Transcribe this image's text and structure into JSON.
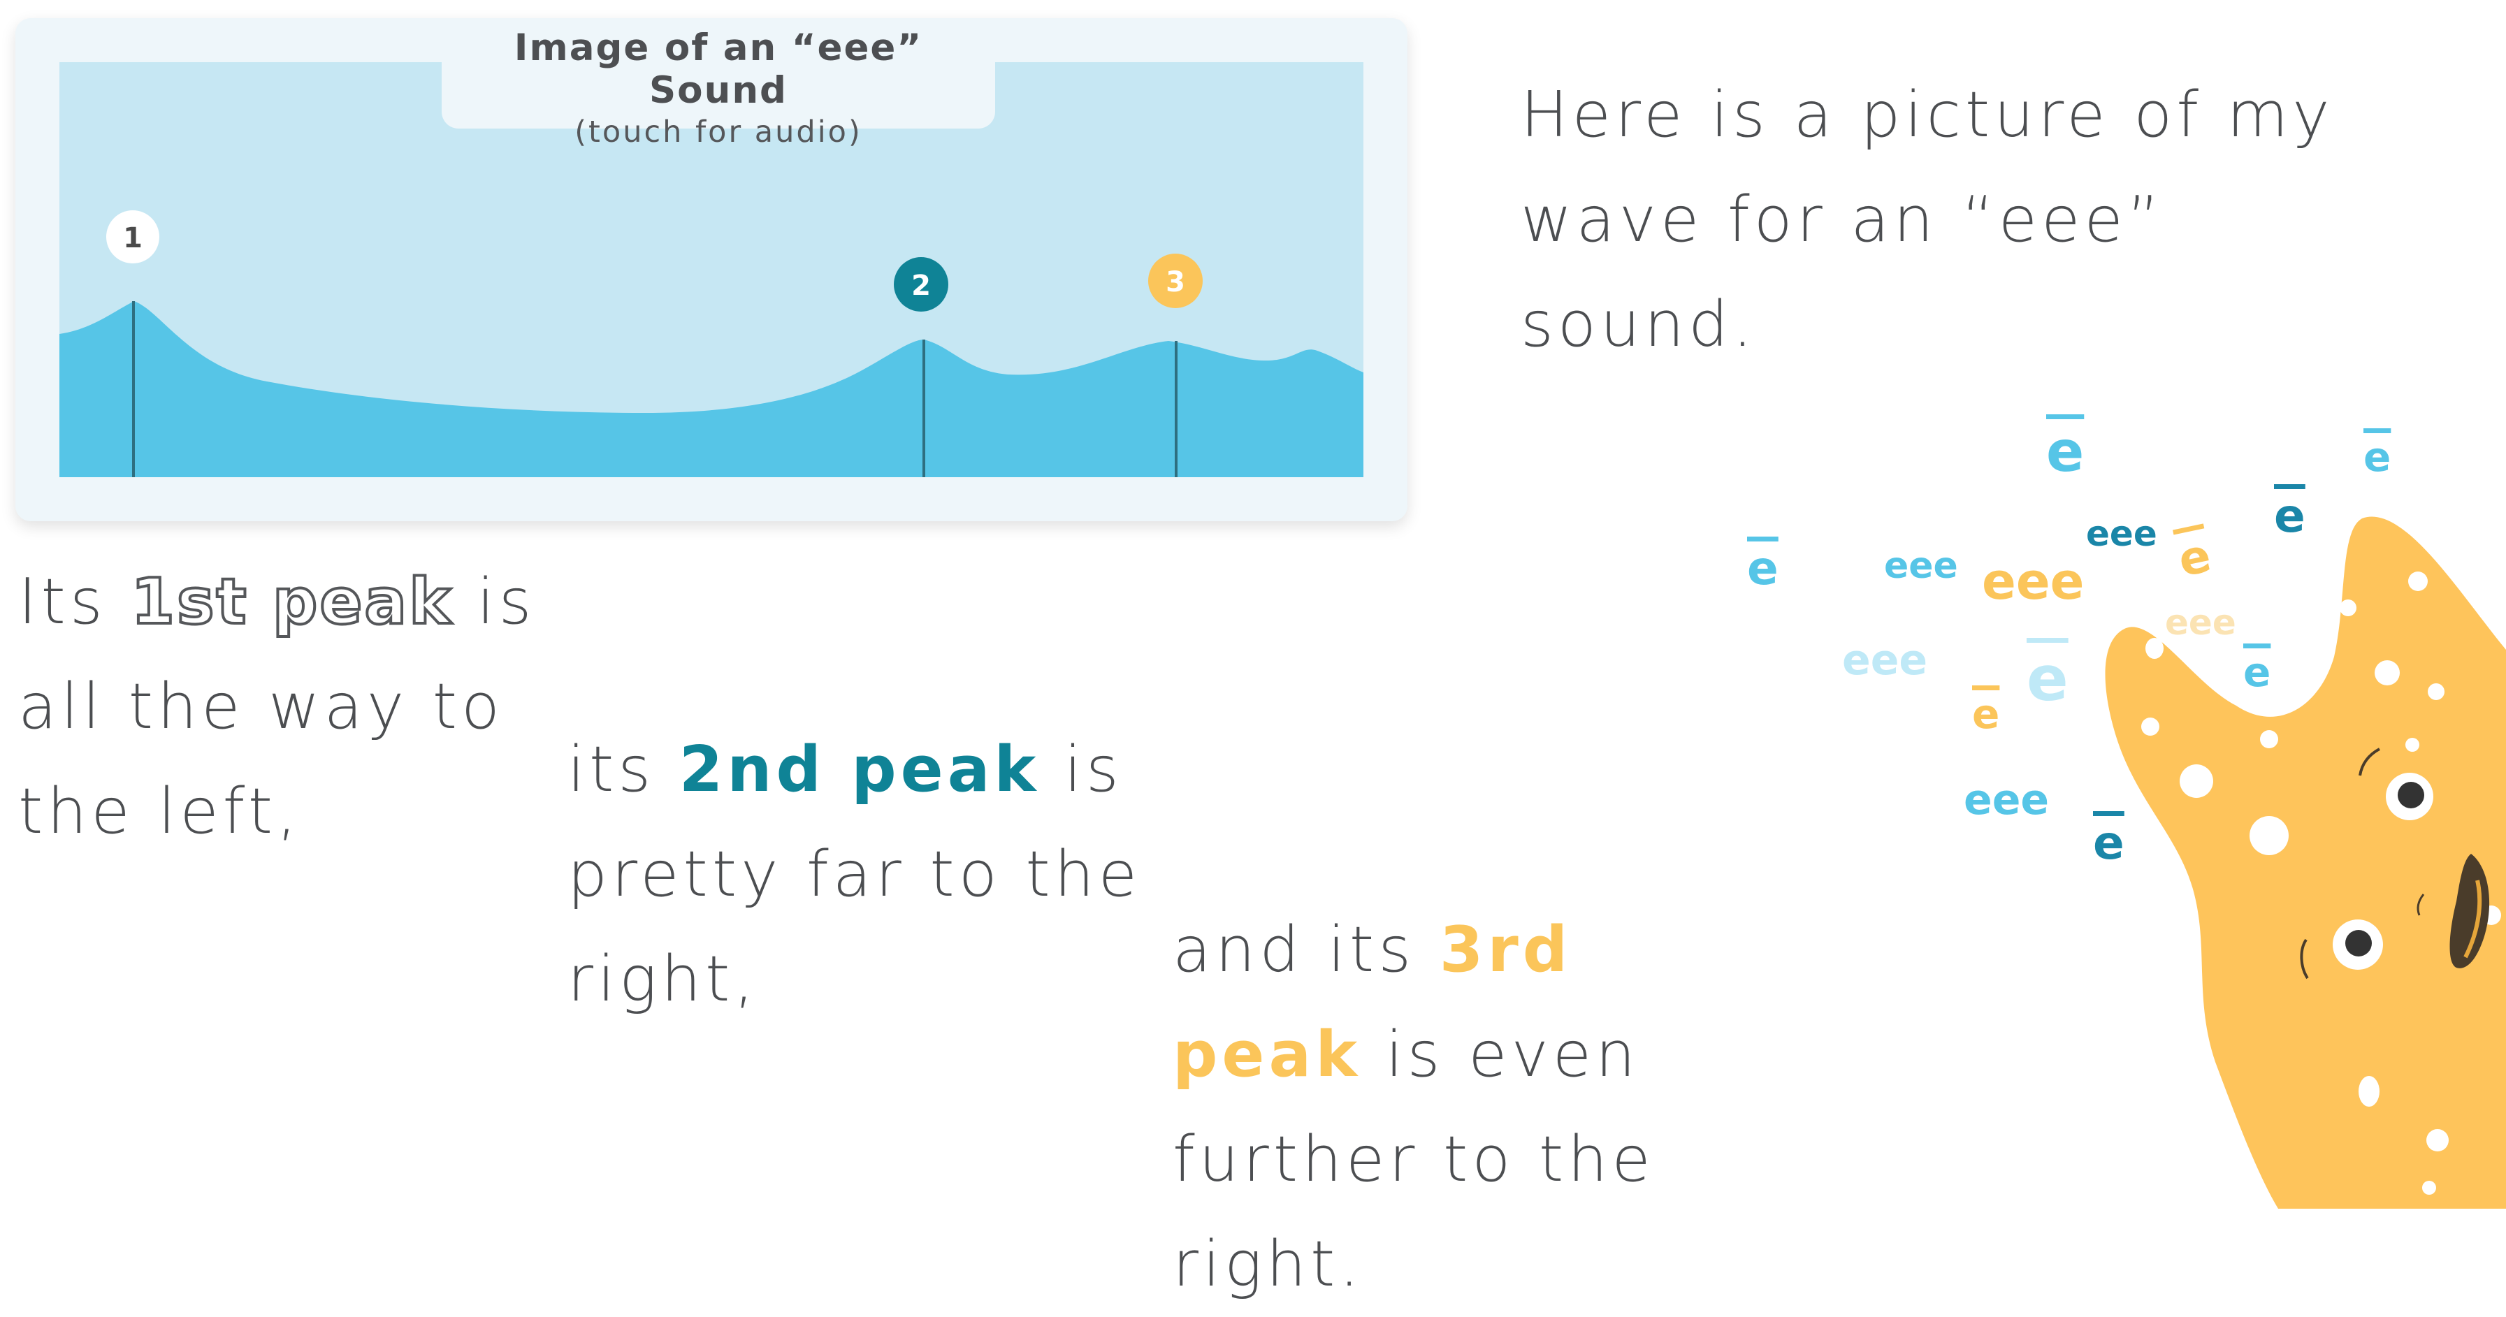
{
  "card": {
    "title": "Image of an “eee” Sound",
    "subtitle": "(touch for audio)",
    "peaks": [
      "1",
      "2",
      "3"
    ]
  },
  "intro": {
    "text": "Here is a picture of my wave for an “eee” sound."
  },
  "peak1": {
    "pre": "Its ",
    "label": "1st peak",
    "post": " is all the way to the left,"
  },
  "peak2": {
    "pre": "its ",
    "label": "2nd peak",
    "post": " is pretty far to the right,"
  },
  "peak3": {
    "pre": "and its ",
    "label": "3rd peak",
    "post": " is even further to the right."
  },
  "letters": {
    "e": "e",
    "eee": "eee"
  },
  "colors": {
    "wave_bg": "#c6e7f3",
    "wave_fill": "#56c5e7",
    "teal": "#0f8396",
    "gold": "#fbc55a",
    "creature": "#fec45b"
  }
}
